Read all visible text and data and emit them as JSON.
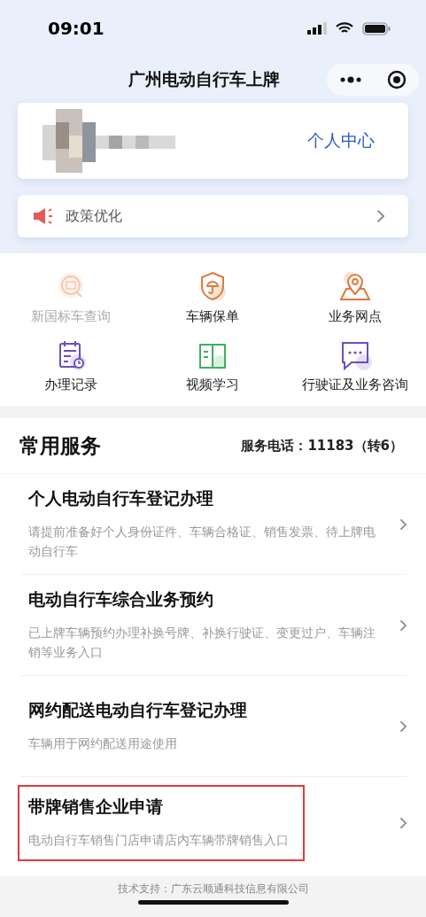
{
  "status_bar": {
    "time": "09:01"
  },
  "nav_bar": {
    "title": "广州电动自行车上牌"
  },
  "user_card": {
    "link": "个人中心"
  },
  "notice": {
    "text": "政策优化"
  },
  "shortcuts": [
    {
      "label": "新国标车查询",
      "kind": "search",
      "disabled": true
    },
    {
      "label": "车辆保单",
      "kind": "shield",
      "disabled": false
    },
    {
      "label": "业务网点",
      "kind": "map",
      "disabled": false
    },
    {
      "label": "办理记录",
      "kind": "record",
      "disabled": false
    },
    {
      "label": "视频学习",
      "kind": "book",
      "disabled": false
    },
    {
      "label": "行驶证及业务咨询",
      "kind": "chat",
      "disabled": false
    }
  ],
  "services": {
    "title": "常用服务",
    "hotline": "服务电话：11183（转6）",
    "items": [
      {
        "title": "个人电动自行车登记办理",
        "description": "请提前准备好个人身份证件、车辆合格证、销售发票、待上牌电动自行车",
        "highlighted": false
      },
      {
        "title": "电动自行车综合业务预约",
        "description": "已上牌车辆预约办理补换号牌、补换行驶证、变更过户、车辆注销等业务入口",
        "highlighted": false
      },
      {
        "title": "网约配送电动自行车登记办理",
        "description": "车辆用于网约配送用途使用",
        "highlighted": false
      },
      {
        "title": "带牌销售企业申请",
        "description": "电动自行车销售门店申请店内车辆带牌销售入口",
        "highlighted": true
      }
    ]
  },
  "footer": {
    "text": "技术支持：广东云顺通科技信息有限公司"
  }
}
